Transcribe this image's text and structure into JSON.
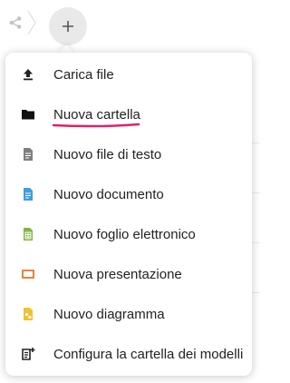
{
  "toolbar": {
    "share_icon": "share-icon",
    "separator_icon": "breadcrumb-separator-icon",
    "add_icon": "plus-icon"
  },
  "menu": {
    "highlight_color": "#e0206a",
    "items": [
      {
        "label": "Carica file",
        "icon": "upload-icon",
        "color": "#222222"
      },
      {
        "label": "Nuova cartella",
        "icon": "folder-icon",
        "color": "#111111"
      },
      {
        "label": "Nuovo file di testo",
        "icon": "text-file-icon",
        "color": "#808080"
      },
      {
        "label": "Nuovo documento",
        "icon": "document-icon",
        "color": "#3d9ee0"
      },
      {
        "label": "Nuovo foglio elettronico",
        "icon": "spreadsheet-icon",
        "color": "#82b541"
      },
      {
        "label": "Nuova presentazione",
        "icon": "presentation-icon",
        "color": "#e8843c"
      },
      {
        "label": "Nuovo diagramma",
        "icon": "diagram-icon",
        "color": "#f1c232"
      },
      {
        "label": "Configura la cartella dei modelli",
        "icon": "template-folder-icon",
        "color": "#222222"
      }
    ]
  }
}
